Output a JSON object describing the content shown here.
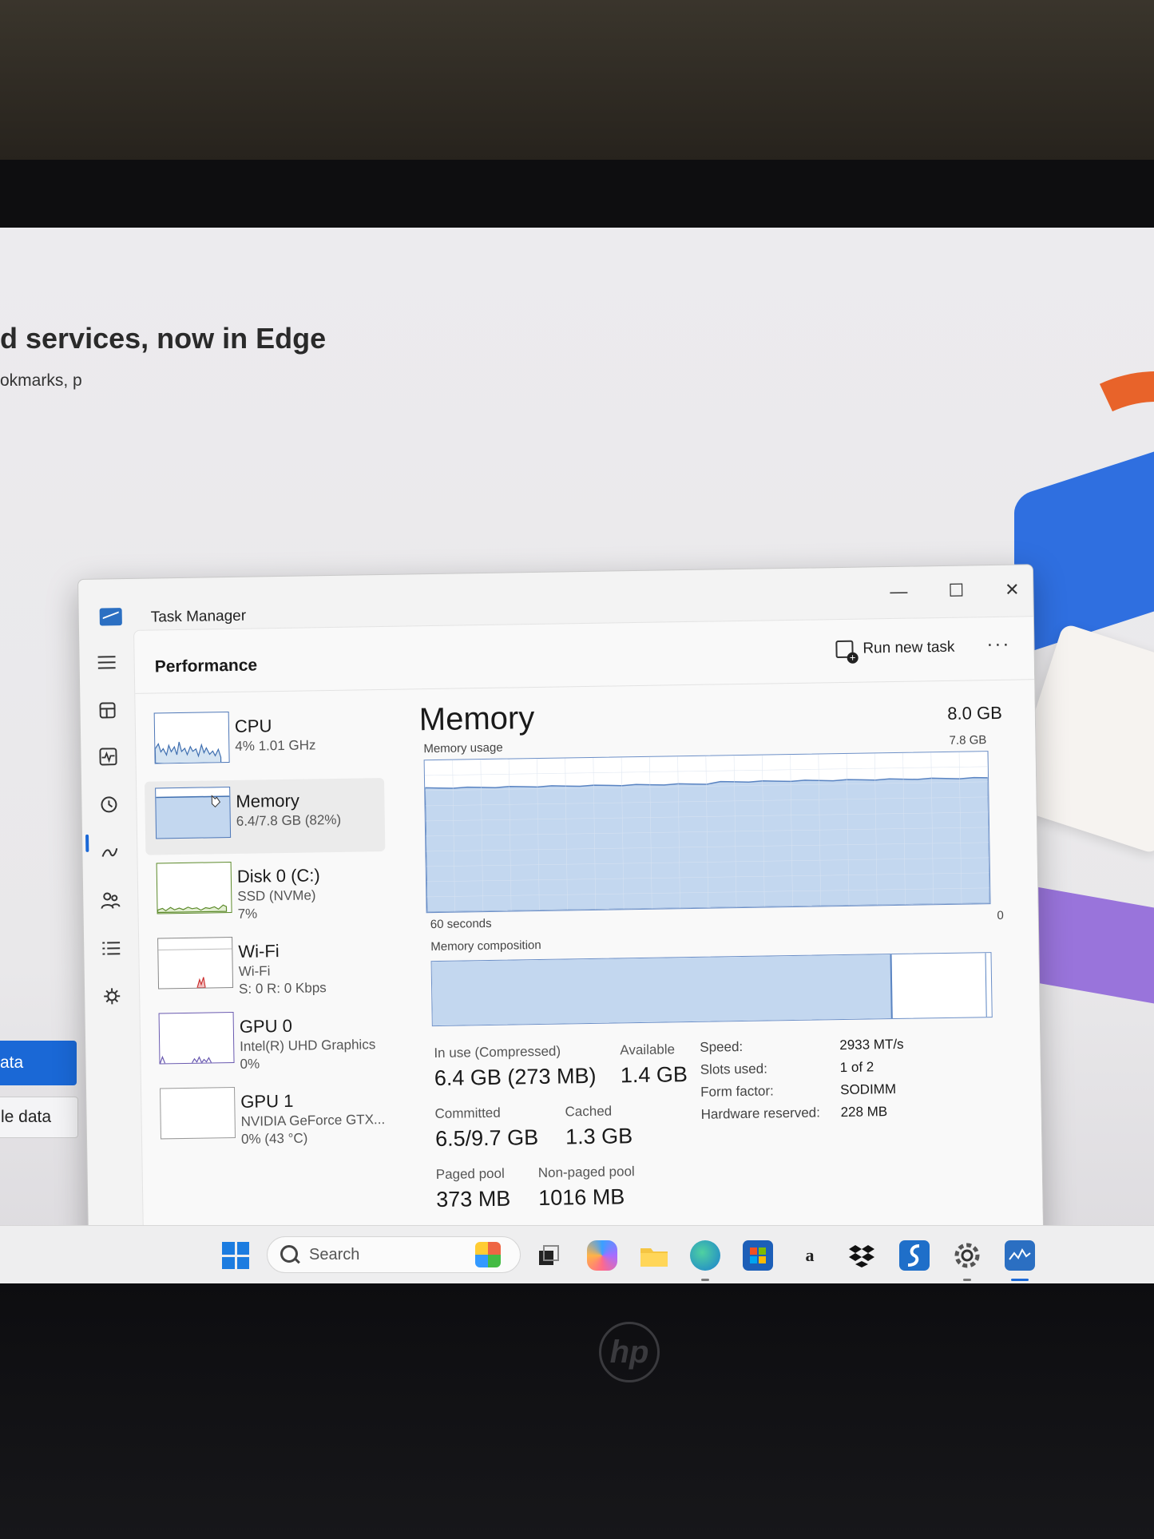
{
  "background_page": {
    "heading": "d services, now in Edge",
    "subtext": "okmarks, p",
    "primary_button": "ata",
    "secondary_button": "le data"
  },
  "window": {
    "title": "Task Manager",
    "minimize_glyph": "—",
    "maximize_glyph": "☐",
    "close_glyph": "✕"
  },
  "nav": {
    "icons": [
      "hamburger-menu-icon",
      "processes-icon",
      "performance-icon",
      "app-history-icon",
      "startup-apps-icon",
      "users-icon",
      "details-icon",
      "services-icon"
    ],
    "settings_icon": "settings-gear-icon"
  },
  "header": {
    "page_title": "Performance",
    "run_new_task_label": "Run new task",
    "more_label": "···"
  },
  "resources": [
    {
      "title": "CPU",
      "sub1": "4%  1.01 GHz",
      "sub2": ""
    },
    {
      "title": "Memory",
      "sub1": "6.4/7.8 GB (82%)",
      "sub2": ""
    },
    {
      "title": "Disk 0 (C:)",
      "sub1": "SSD (NVMe)",
      "sub2": "7%"
    },
    {
      "title": "Wi-Fi",
      "sub1": "Wi-Fi",
      "sub2": "S: 0  R: 0 Kbps"
    },
    {
      "title": "GPU 0",
      "sub1": "Intel(R) UHD Graphics",
      "sub2": "0%"
    },
    {
      "title": "GPU 1",
      "sub1": "NVIDIA GeForce GTX...",
      "sub2": "0% (43 °C)"
    }
  ],
  "memory": {
    "title": "Memory",
    "total": "8.0 GB",
    "usage_label": "Memory usage",
    "usage_max": "7.8 GB",
    "time_span": "60 seconds",
    "time_end": "0",
    "composition_label": "Memory composition",
    "usage_fraction": 0.82,
    "standby_fraction": 0.17,
    "stats": {
      "in_use_label": "In use (Compressed)",
      "in_use_value": "6.4 GB (273 MB)",
      "available_label": "Available",
      "available_value": "1.4 GB",
      "committed_label": "Committed",
      "committed_value": "6.5/9.7 GB",
      "cached_label": "Cached",
      "cached_value": "1.3 GB",
      "paged_pool_label": "Paged pool",
      "paged_pool_value": "373 MB",
      "non_paged_pool_label": "Non-paged pool",
      "non_paged_pool_value": "1016 MB"
    },
    "specs": {
      "speed_label": "Speed:",
      "speed_value": "2933 MT/s",
      "slots_label": "Slots used:",
      "slots_value": "1 of 2",
      "form_label": "Form factor:",
      "form_value": "SODIMM",
      "reserved_label": "Hardware reserved:",
      "reserved_value": "228 MB"
    }
  },
  "taskbar": {
    "search_placeholder": "Search",
    "apps": [
      "task-view",
      "copilot",
      "file-explorer",
      "edge",
      "microsoft-store",
      "amazon",
      "dropbox",
      "sharpkeys",
      "settings",
      "task-manager"
    ],
    "amazon_glyph": "a"
  },
  "colors": {
    "accent": "#1a68d6",
    "graph_fill": "#c3d7ef",
    "graph_line": "#5a84c2"
  }
}
